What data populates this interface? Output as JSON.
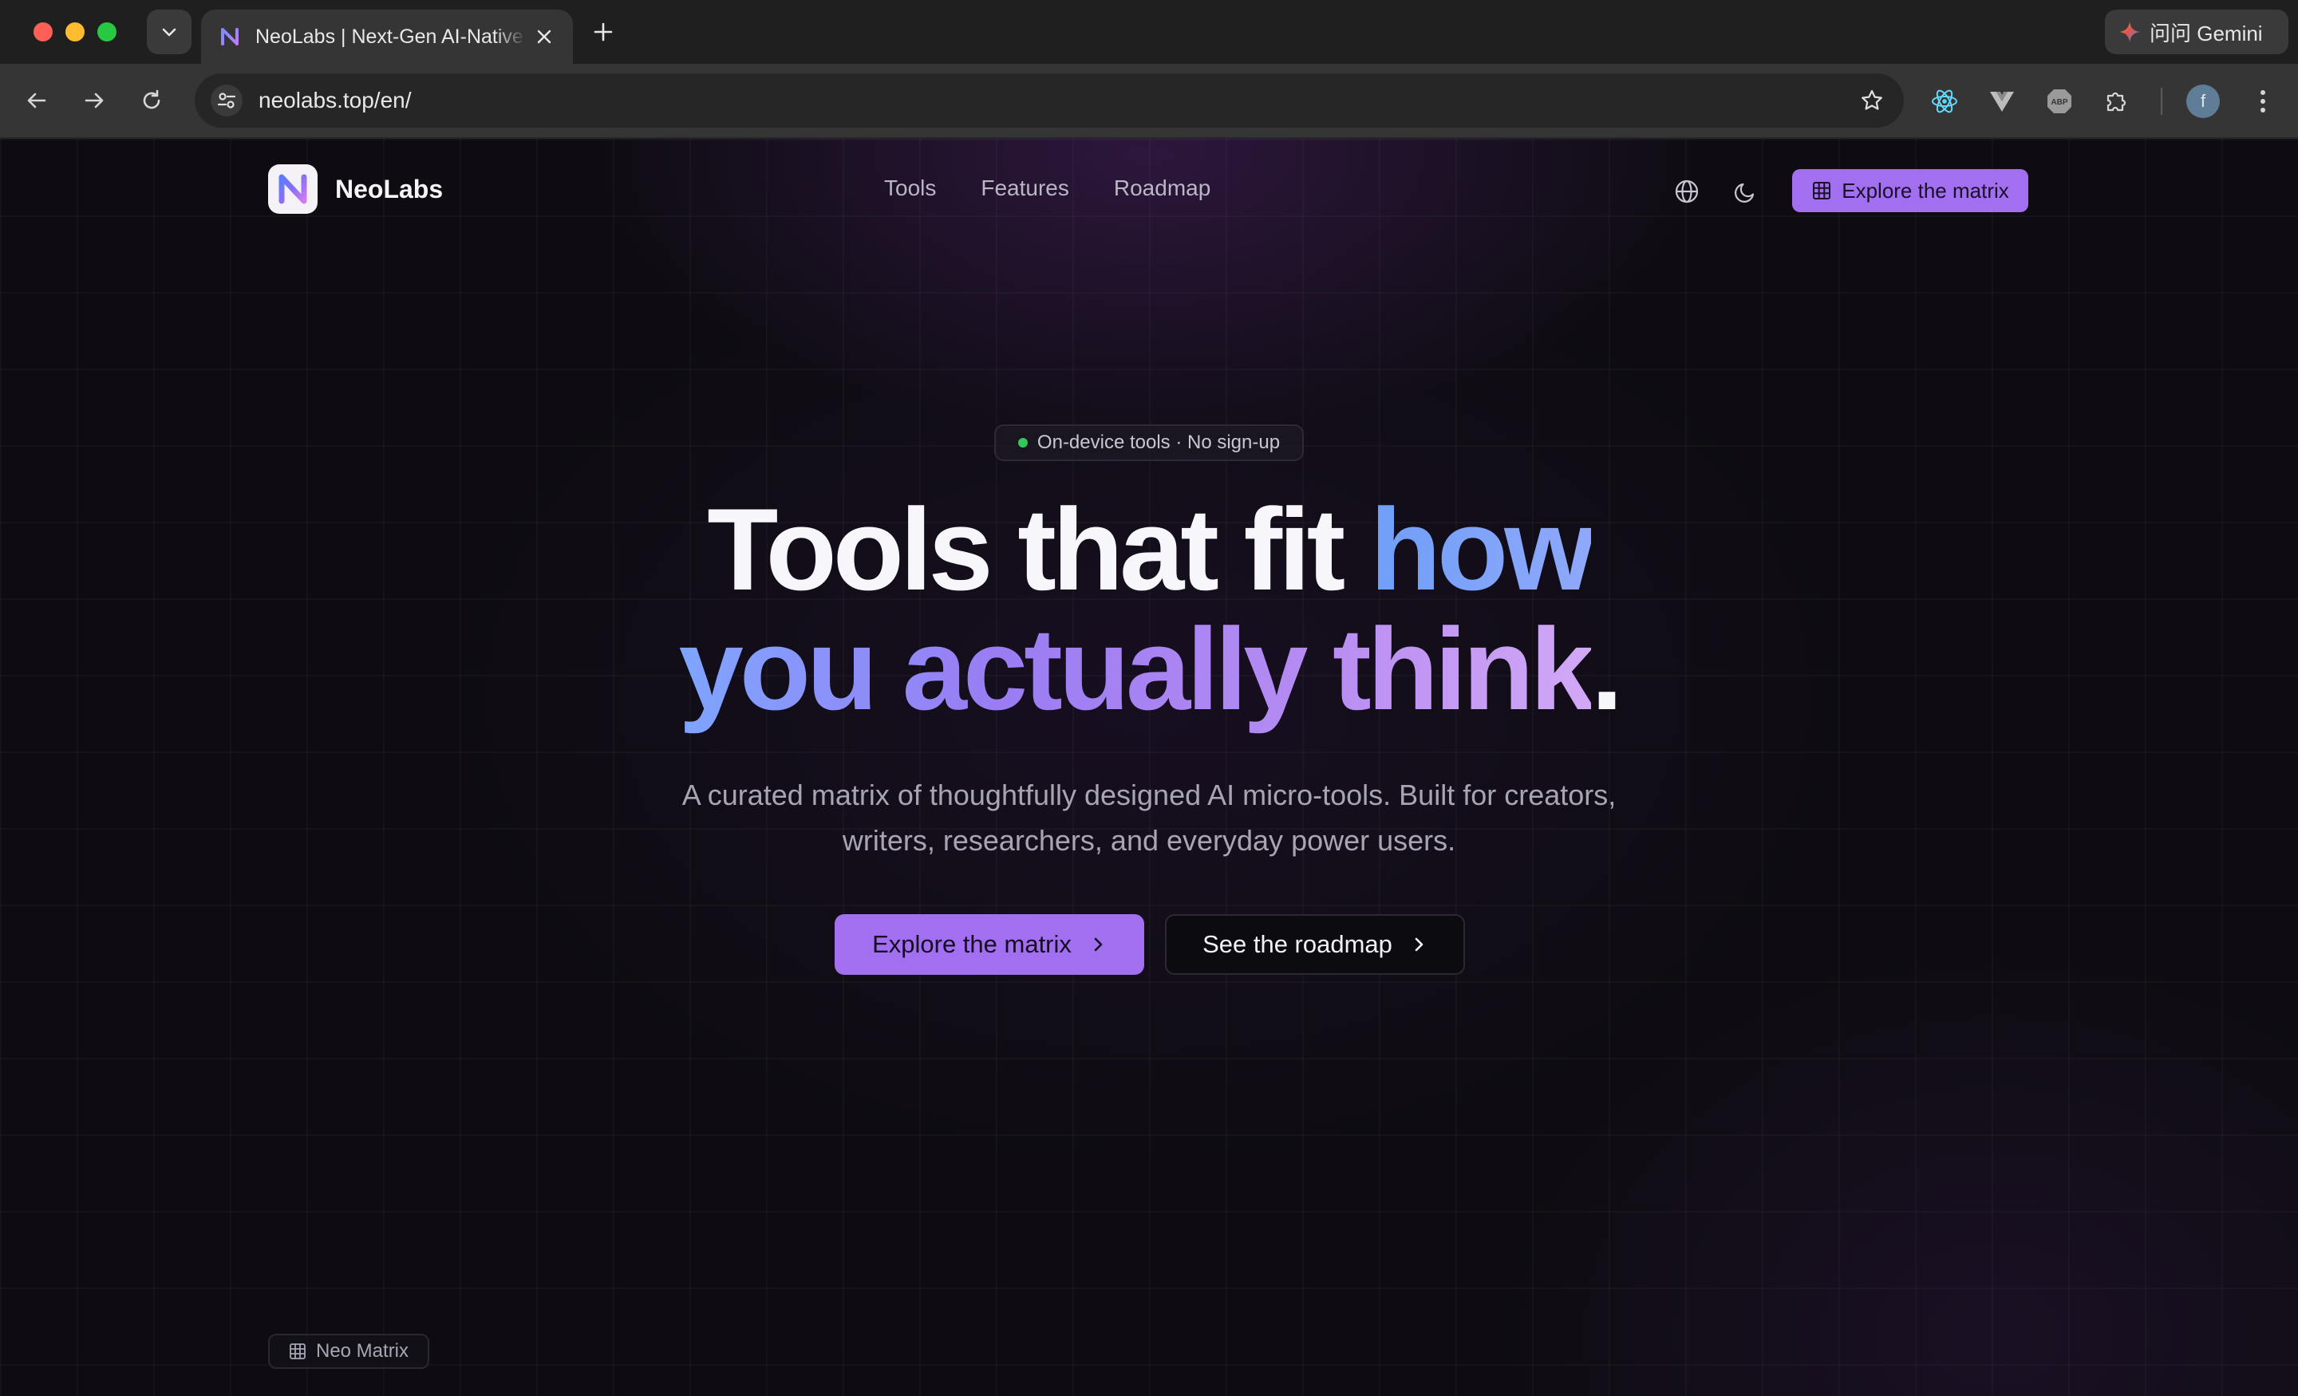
{
  "browser": {
    "tab": {
      "title": "NeoLabs | Next-Gen AI-Native Tools"
    },
    "url": "neolabs.top/en/",
    "gemini_label": "问问 Gemini",
    "profile_initial": "f"
  },
  "site": {
    "brand": "NeoLabs",
    "nav": [
      "Tools",
      "Features",
      "Roadmap"
    ],
    "nav_cta": "Explore the matrix",
    "badge": "On-device tools · No sign-up",
    "headline": {
      "part1": "Tools that fit ",
      "part2": "how",
      "part3": "you actually think",
      "part4": "."
    },
    "subtitle_line1": "A curated matrix of thoughtfully designed AI micro-tools. Built for creators,",
    "subtitle_line2": "writers, researchers, and everyday power users.",
    "primary_cta": "Explore the matrix",
    "secondary_cta": "See the roadmap",
    "corner_label": "Neo Matrix"
  },
  "colors": {
    "accent": "#a26ff0",
    "background": "#0e0c12",
    "status_dot": "#34c759"
  },
  "icons": {
    "nav_back": "arrow-left-icon",
    "nav_forward": "arrow-right-icon",
    "reload": "reload-icon",
    "bookmark": "star-icon",
    "language": "globe-icon",
    "theme": "moon-icon",
    "matrix": "grid-icon"
  }
}
